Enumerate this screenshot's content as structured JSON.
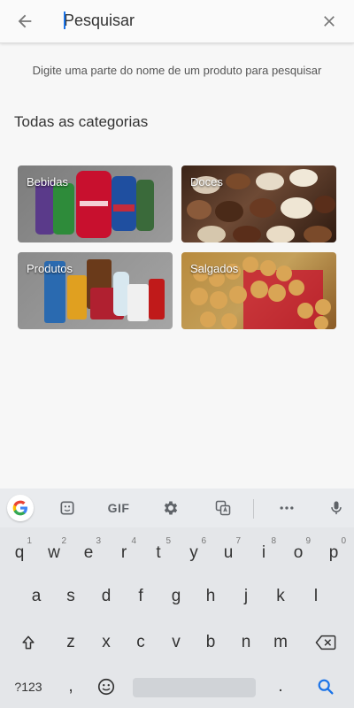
{
  "header": {
    "search_placeholder": "Pesquisar"
  },
  "hint_text": "Digite uma parte do nome de um produto para pesquisar",
  "section_title": "Todas as categorias",
  "categories": [
    {
      "label": "Bebidas"
    },
    {
      "label": "Doces"
    },
    {
      "label": "Produtos"
    },
    {
      "label": "Salgados"
    }
  ],
  "keyboard": {
    "toolbar": {
      "gif_label": "GIF"
    },
    "row1": [
      {
        "key": "q",
        "hint": "1"
      },
      {
        "key": "w",
        "hint": "2"
      },
      {
        "key": "e",
        "hint": "3"
      },
      {
        "key": "r",
        "hint": "4"
      },
      {
        "key": "t",
        "hint": "5"
      },
      {
        "key": "y",
        "hint": "6"
      },
      {
        "key": "u",
        "hint": "7"
      },
      {
        "key": "i",
        "hint": "8"
      },
      {
        "key": "o",
        "hint": "9"
      },
      {
        "key": "p",
        "hint": "0"
      }
    ],
    "row2": [
      "a",
      "s",
      "d",
      "f",
      "g",
      "h",
      "j",
      "k",
      "l"
    ],
    "row3": [
      "z",
      "x",
      "c",
      "v",
      "b",
      "n",
      "m"
    ],
    "symbols_label": "?123",
    "comma": ",",
    "period": "."
  },
  "colors": {
    "caret": "#1a73e8",
    "search_key": "#1a73e8"
  }
}
